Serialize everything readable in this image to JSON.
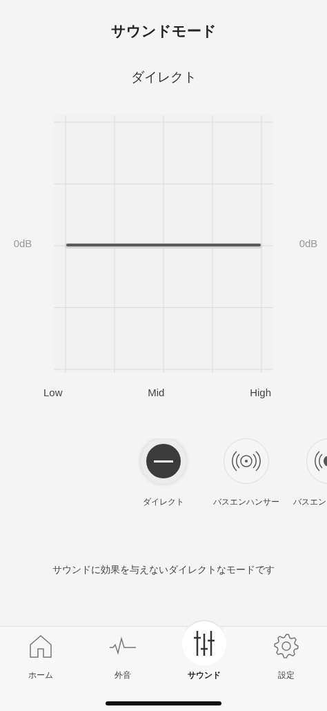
{
  "title": "サウンドモード",
  "mode_name": "ダイレクト",
  "eq": {
    "left_label": "0dB",
    "right_label": "0dB",
    "x_labels": [
      "Low",
      "Mid",
      "High"
    ]
  },
  "modes": [
    {
      "label": "ダイレクト",
      "kind": "flat",
      "selected": true
    },
    {
      "label": "バスエンハンサー",
      "kind": "bass",
      "selected": false
    },
    {
      "label": "バスエン",
      "kind": "bass_plus",
      "selected": false
    }
  ],
  "description": "サウンドに効果を与えないダイレクトなモードです",
  "tabs": [
    {
      "label": "ホーム",
      "kind": "home",
      "selected": false
    },
    {
      "label": "外音",
      "kind": "ambient",
      "selected": false
    },
    {
      "label": "サウンド",
      "kind": "sound",
      "selected": true
    },
    {
      "label": "設定",
      "kind": "settings",
      "selected": false
    }
  ]
}
